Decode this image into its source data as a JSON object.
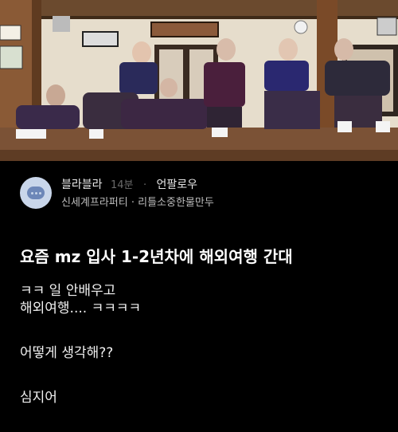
{
  "post": {
    "author": "블라블라",
    "time": "14분",
    "separator": "·",
    "channel": "언팔로우",
    "company_line": "신세계프라퍼티 · 리틀소중한물만두",
    "title": "요즘 mz 입사 1-2년차에 해외여행 간대",
    "body_lines": [
      "ㅋㅋ 일 안배우고",
      "해외여행.... ㅋㅋㅋㅋ",
      "어떻게 생각해??",
      "심지어"
    ]
  },
  "colors": {
    "background": "#000000",
    "avatar_bg": "#c9d6ea",
    "avatar_icon": "#6d87b8",
    "muted_text": "#6a6a6a"
  },
  "icons": {
    "avatar": "chat-bubble-icon"
  }
}
